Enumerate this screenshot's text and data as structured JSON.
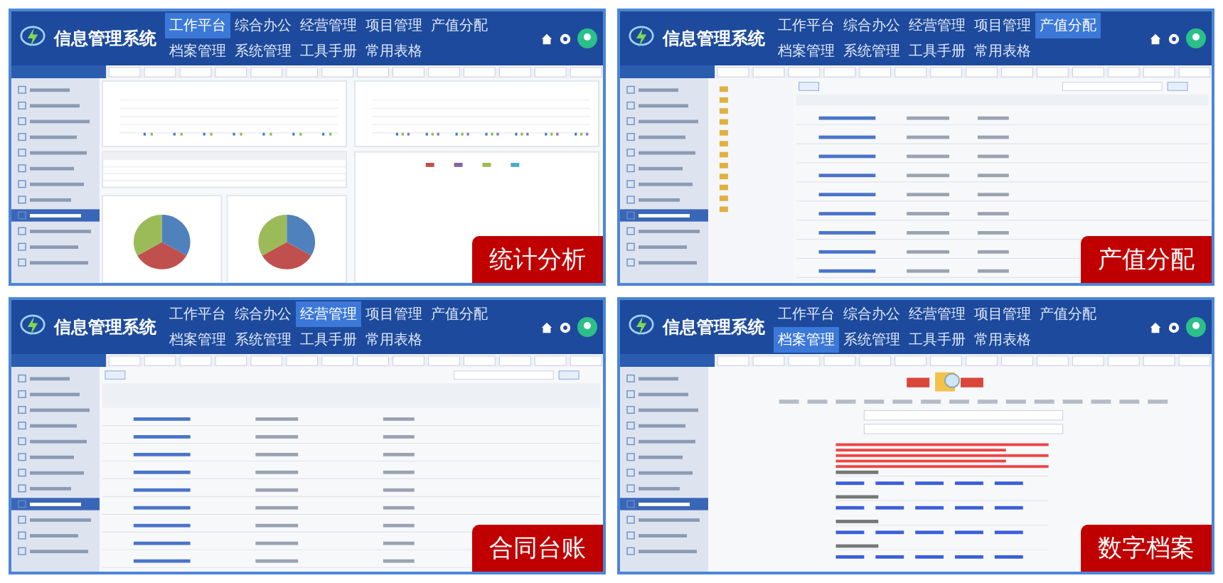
{
  "screens": [
    {
      "title": "信息管理系统",
      "kind": "dashboard",
      "caption": "统计分析",
      "nav": [
        {
          "label": "工作平台",
          "selected": true
        },
        {
          "label": "综合办公",
          "selected": false
        },
        {
          "label": "经营管理",
          "selected": false
        },
        {
          "label": "项目管理",
          "selected": false
        },
        {
          "label": "产值分配",
          "selected": false
        },
        {
          "label": "档案管理",
          "selected": false
        },
        {
          "label": "系统管理",
          "selected": false
        },
        {
          "label": "工具手册",
          "selected": false
        },
        {
          "label": "常用表格",
          "selected": false
        }
      ]
    },
    {
      "title": "信息管理系统",
      "kind": "table",
      "caption": "产值分配",
      "nav": [
        {
          "label": "工作平台",
          "selected": false
        },
        {
          "label": "综合办公",
          "selected": false
        },
        {
          "label": "经营管理",
          "selected": false
        },
        {
          "label": "项目管理",
          "selected": false
        },
        {
          "label": "产值分配",
          "selected": true
        },
        {
          "label": "档案管理",
          "selected": false
        },
        {
          "label": "系统管理",
          "selected": false
        },
        {
          "label": "工具手册",
          "selected": false
        },
        {
          "label": "常用表格",
          "selected": false
        }
      ]
    },
    {
      "title": "信息管理系统",
      "kind": "ledger",
      "caption": "合同台账",
      "nav": [
        {
          "label": "工作平台",
          "selected": false
        },
        {
          "label": "综合办公",
          "selected": false
        },
        {
          "label": "经营管理",
          "selected": true
        },
        {
          "label": "项目管理",
          "selected": false
        },
        {
          "label": "产值分配",
          "selected": false
        },
        {
          "label": "档案管理",
          "selected": false
        },
        {
          "label": "系统管理",
          "selected": false
        },
        {
          "label": "工具手册",
          "selected": false
        },
        {
          "label": "常用表格",
          "selected": false
        }
      ]
    },
    {
      "title": "信息管理系统",
      "kind": "archive",
      "caption": "数字档案",
      "nav": [
        {
          "label": "工作平台",
          "selected": false
        },
        {
          "label": "综合办公",
          "selected": false
        },
        {
          "label": "经营管理",
          "selected": false
        },
        {
          "label": "项目管理",
          "selected": false
        },
        {
          "label": "产值分配",
          "selected": false
        },
        {
          "label": "档案管理",
          "selected": true
        },
        {
          "label": "系统管理",
          "selected": false
        },
        {
          "label": "工具手册",
          "selected": false
        },
        {
          "label": "常用表格",
          "selected": false
        }
      ]
    }
  ]
}
